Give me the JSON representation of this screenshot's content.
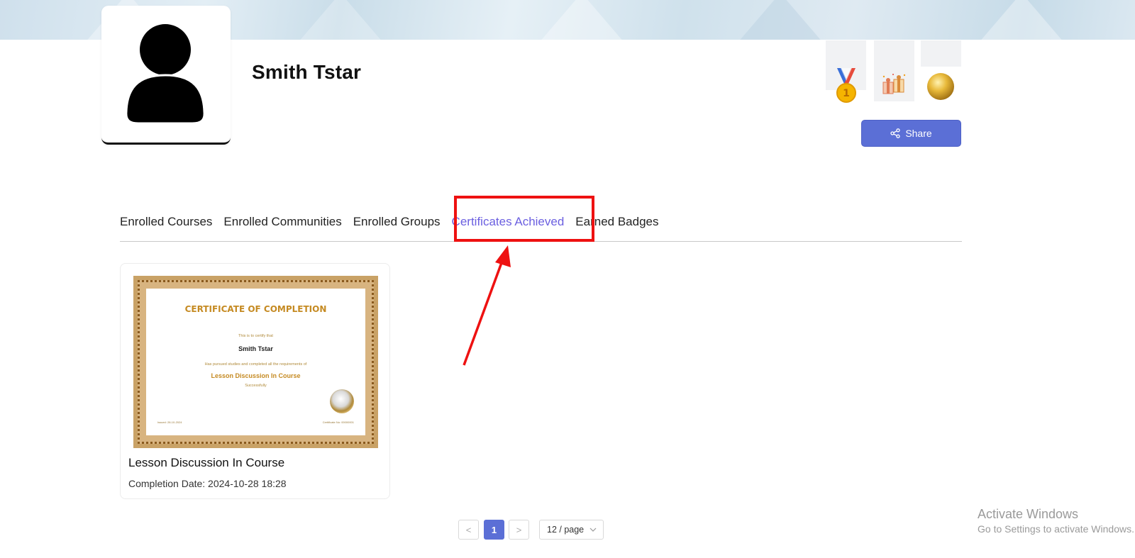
{
  "profile": {
    "name": "Smith Tstar"
  },
  "badges": [
    {
      "icon": "medal-icon"
    },
    {
      "icon": "gift-icon"
    },
    {
      "icon": "gold-coin-icon"
    }
  ],
  "share": {
    "label": "Share",
    "icon": "share-icon"
  },
  "tabs": [
    {
      "label": "Enrolled Courses"
    },
    {
      "label": "Enrolled Communities"
    },
    {
      "label": "Enrolled Groups"
    },
    {
      "label": "Certificates Achieved",
      "active": true
    },
    {
      "label": "Earned Badges"
    }
  ],
  "certificate": {
    "heading": "CERTIFICATE OF COMPLETION",
    "certify_text": "This is to certify that",
    "person": "Smith Tstar",
    "pursued_text": "Has pursued studies and completed all the requirements of",
    "course": "Lesson Discussion In Course",
    "successfully": "Successfully",
    "issued_text": "Issued: 28-10-2024",
    "cert_no": "Certificate No: 00000001",
    "title": "Lesson Discussion In Course",
    "completion_date": "Completion Date: 2024-10-28 18:28"
  },
  "pagination": {
    "prev": "<",
    "current": "1",
    "next": ">",
    "page_size": "12 / page"
  },
  "windows_watermark": {
    "line1": "Activate Windows",
    "line2": "Go to Settings to activate Windows."
  },
  "colors": {
    "accent": "#5b6fd6",
    "active_tab": "#6b5fe0",
    "highlight": "#ee1111",
    "cert_gold": "#c58a22"
  }
}
